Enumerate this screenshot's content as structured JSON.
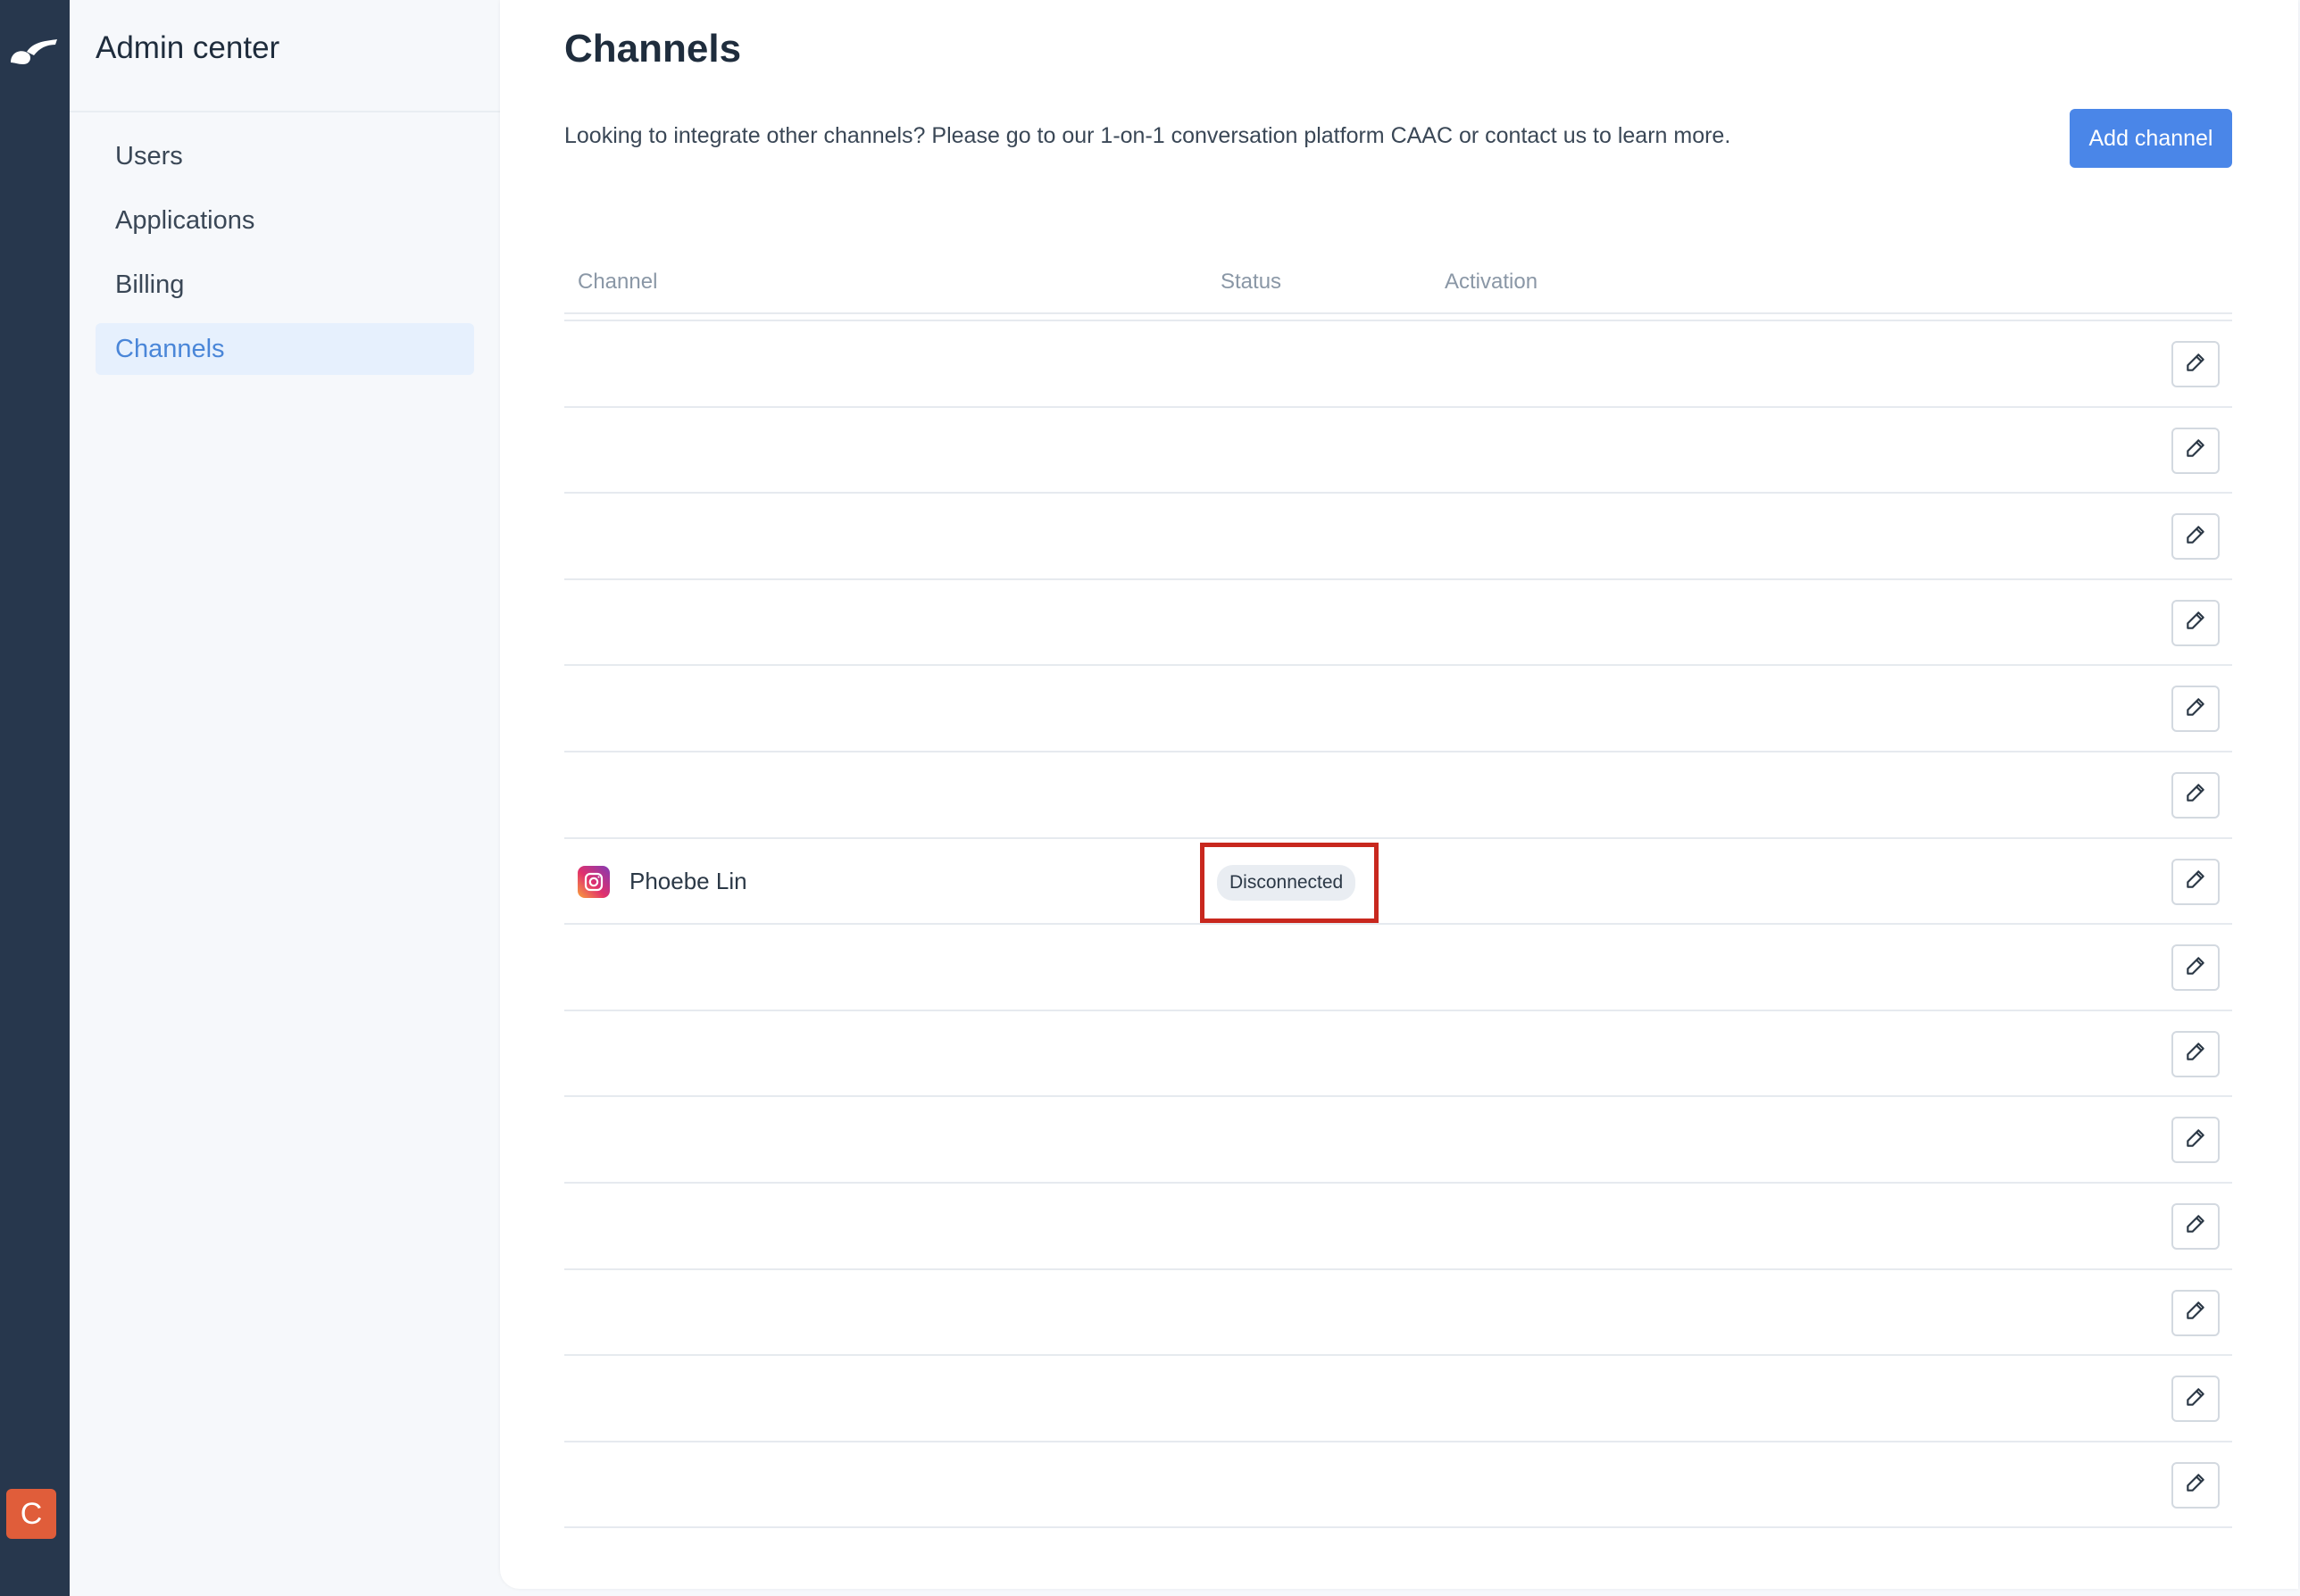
{
  "sidebar": {
    "title": "Admin center",
    "items": [
      {
        "label": "Users",
        "active": false
      },
      {
        "label": "Applications",
        "active": false
      },
      {
        "label": "Billing",
        "active": false
      },
      {
        "label": "Channels",
        "active": true
      }
    ]
  },
  "user": {
    "avatar_letter": "C",
    "avatar_color": "#e05d3a"
  },
  "main": {
    "title": "Channels",
    "intro": "Looking to integrate other channels? Please go to our 1-on-1 conversation platform CAAC or contact us to learn more.",
    "add_button": "Add channel"
  },
  "table": {
    "columns": [
      "Channel",
      "Status",
      "Activation"
    ],
    "rows": [
      {
        "channel": "",
        "status": "",
        "activation": ""
      },
      {
        "channel": "",
        "status": "",
        "activation": ""
      },
      {
        "channel": "",
        "status": "",
        "activation": ""
      },
      {
        "channel": "",
        "status": "",
        "activation": ""
      },
      {
        "channel": "",
        "status": "",
        "activation": ""
      },
      {
        "channel": "",
        "status": "",
        "activation": ""
      },
      {
        "channel": "Phoebe Lin",
        "icon": "instagram-icon",
        "status": "Disconnected",
        "activation": "",
        "highlighted": true
      },
      {
        "channel": "",
        "status": "",
        "activation": ""
      },
      {
        "channel": "",
        "status": "",
        "activation": ""
      },
      {
        "channel": "",
        "status": "",
        "activation": ""
      },
      {
        "channel": "",
        "status": "",
        "activation": ""
      },
      {
        "channel": "",
        "status": "",
        "activation": ""
      },
      {
        "channel": "",
        "status": "",
        "activation": ""
      },
      {
        "channel": "",
        "status": "",
        "activation": ""
      }
    ]
  },
  "colors": {
    "accent": "#4a86e8",
    "rail": "#27374d",
    "highlight": "#c8281e"
  }
}
